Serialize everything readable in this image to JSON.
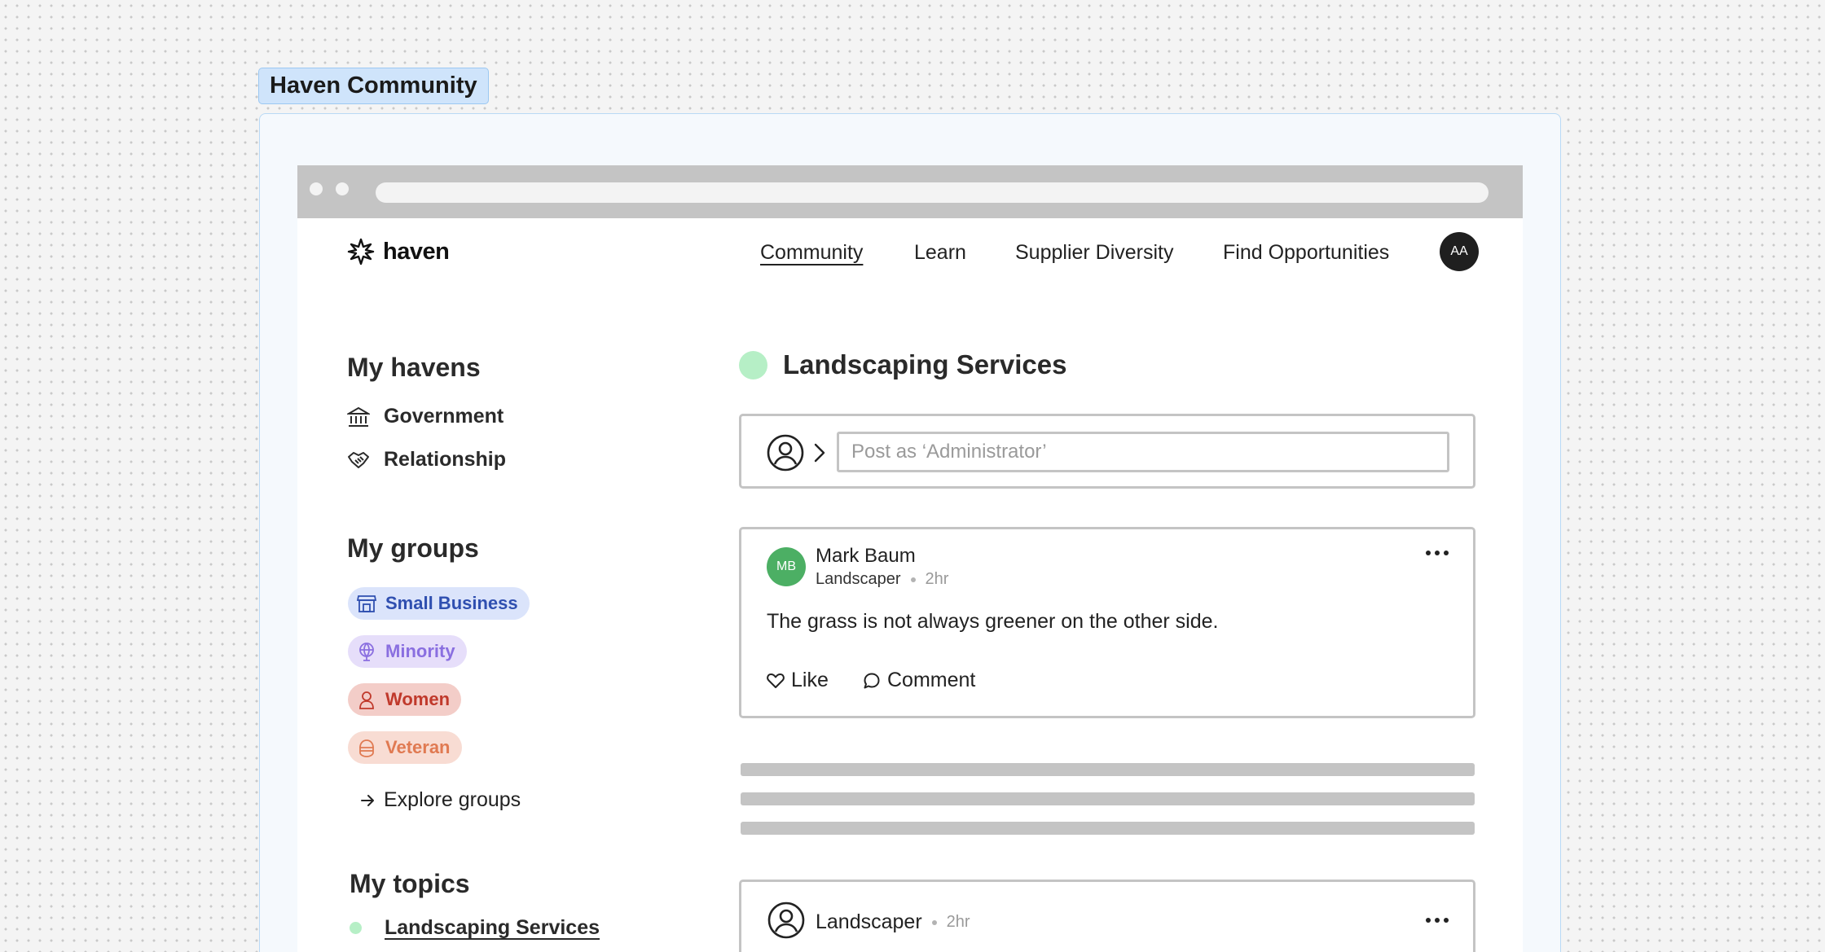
{
  "frame": {
    "label": "Haven Community"
  },
  "header": {
    "logo_text": "haven",
    "nav": [
      "Community",
      "Learn",
      "Supplier Diversity",
      "Find Opportunities"
    ],
    "active_nav": "Community",
    "user_initials": "AA"
  },
  "sidebar": {
    "havens_title": "My havens",
    "havens": [
      {
        "label": "Government",
        "icon": "government-building-icon"
      },
      {
        "label": "Relationship",
        "icon": "handshake-icon"
      }
    ],
    "groups_title": "My groups",
    "groups": [
      {
        "label": "Small Business",
        "icon": "storefront-icon",
        "bg": "#dbe4fb",
        "color": "#2f4fb0"
      },
      {
        "label": "Minority",
        "icon": "globe-icon",
        "bg": "#e6defa",
        "color": "#8a6fe0"
      },
      {
        "label": "Women",
        "icon": "woman-icon",
        "bg": "#f3cdc8",
        "color": "#c0392b"
      },
      {
        "label": "Veteran",
        "icon": "helmet-icon",
        "bg": "#f8dcd3",
        "color": "#e07a52"
      }
    ],
    "explore_label": "Explore groups",
    "topics_title": "My topics",
    "topics": [
      {
        "label": "Landscaping Services",
        "color": "#b6efc6"
      }
    ]
  },
  "main": {
    "topic_title": "Landscaping Services",
    "topic_color": "#b6efc6",
    "composer": {
      "placeholder": "Post as ‘Administrator’"
    },
    "posts": [
      {
        "avatar_initials": "MB",
        "avatar_color": "#4caf64",
        "author": "Mark Baum",
        "role": "Landscaper",
        "time": "2hr",
        "body": "The grass is not always greener on the other side.",
        "like_label": "Like",
        "comment_label": "Comment"
      },
      {
        "author": "Landscaper",
        "time": "2hr"
      }
    ]
  }
}
